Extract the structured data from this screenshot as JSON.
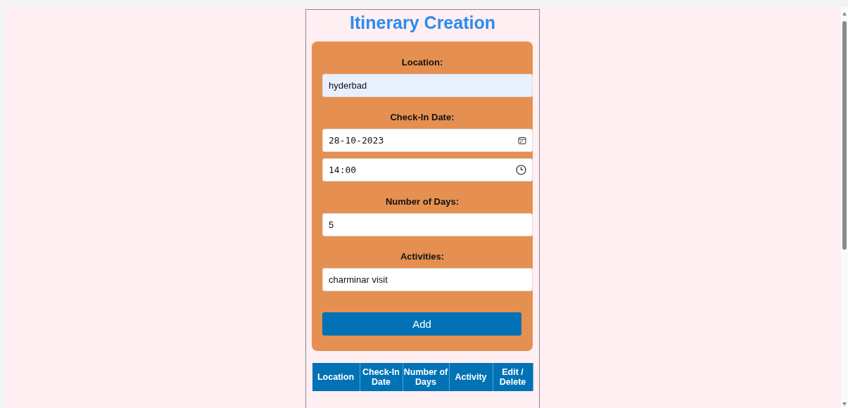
{
  "title": "Itinerary Creation",
  "form": {
    "fields": [
      {
        "label": "Location:",
        "inputs": [
          {
            "kind": "text",
            "value": "hyderbad",
            "autofilled": true
          }
        ]
      },
      {
        "label": "Check-In Date:",
        "inputs": [
          {
            "kind": "date",
            "value": "28-10-2023",
            "autofilled": false
          },
          {
            "kind": "time",
            "value": "14:00",
            "autofilled": false
          }
        ]
      },
      {
        "label": "Number of Days:",
        "inputs": [
          {
            "kind": "text",
            "value": "5",
            "autofilled": false
          }
        ]
      },
      {
        "label": "Activities:",
        "inputs": [
          {
            "kind": "text",
            "value": "charminar visit",
            "autofilled": false
          }
        ]
      }
    ],
    "button": "Add"
  },
  "table": {
    "columns": [
      "Location",
      "Check-In Date",
      "Number of Days",
      "Activity",
      "Edit / Delete"
    ]
  }
}
